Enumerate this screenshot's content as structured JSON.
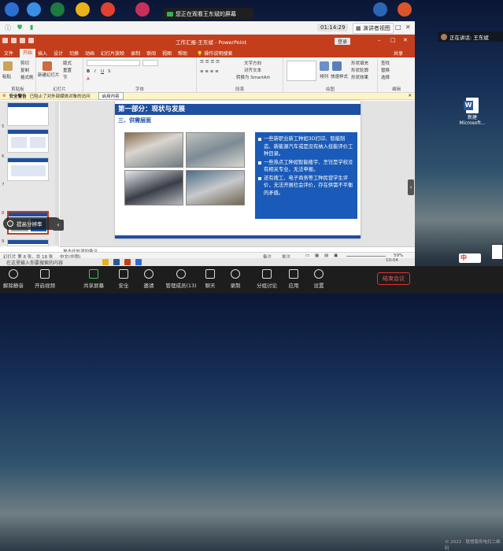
{
  "banner": {
    "text": "您正在观看王东斌的屏幕"
  },
  "zoom_toolbar": {
    "timer": "01:14:29",
    "view_button": "演讲者视图"
  },
  "speaker": {
    "label": "正在讲话: 王东斌"
  },
  "desktop": {
    "word_file": "新建 Microsoft..."
  },
  "ppt": {
    "title": "工作汇报-王东斌 - PowerPoint",
    "login": "登录",
    "tabs": [
      "文件",
      "开始",
      "插入",
      "设计",
      "切换",
      "动画",
      "幻灯片放映",
      "录制",
      "审阅",
      "视图",
      "帮助",
      "操作说明搜索"
    ],
    "share": "共享",
    "ribbon": {
      "clipboard": {
        "paste": "粘贴",
        "cut": "剪切",
        "copy": "复制",
        "format": "格式刷",
        "label": "剪贴板"
      },
      "slides": {
        "new": "新建幻灯片",
        "layout": "版式",
        "reset": "重置",
        "section": "节",
        "label": "幻灯片"
      },
      "font": {
        "label": "字体"
      },
      "paragraph": {
        "label": "段落",
        "textdir": "文字方向",
        "align": "对齐文本",
        "smartart": "转换为 SmartArt"
      },
      "drawing": {
        "shape_fill": "形状填充",
        "shape_outline": "形状轮廓",
        "shape_effect": "形状效果",
        "arrange": "排列",
        "quick": "快速样式",
        "label": "绘图"
      },
      "editing": {
        "find": "查找",
        "replace": "替换",
        "select": "选择",
        "label": "编辑"
      }
    },
    "security": {
      "title": "安全警告",
      "msg": "已阻止了对外部媒体对象的访问",
      "btn": "启用内容"
    },
    "slide_numbers": [
      "5",
      "6",
      "7",
      "8",
      "9"
    ],
    "slide": {
      "header": "第一部分：现状与发展",
      "subheader": "三、供需层面",
      "points": [
        "一些新职业新工种如3D打印、智能制造、新能源汽车或是没有纳入技能评价工种目录。",
        "一些热点工种如智能楼宇、烹饪是学校没有相关专业，无法申报。",
        "还有搜工、电子商务等工种民营学生评价，无法开展社会评价，存在供需不平衡的矛盾。"
      ]
    },
    "notes": "单击此处添加备注",
    "status": {
      "slide": "幻灯片 第 8 张，共 18 张",
      "lang": "中文(中国)",
      "notes": "备注",
      "comments": "批注",
      "zoom": "59%"
    }
  },
  "float_toolbar": {
    "label": "提高分辨率"
  },
  "taskbar": {
    "text": "在这里输入你要搜索的内容",
    "time": "10:04",
    "date": "2022/6/..."
  },
  "controls": {
    "items": [
      "解除静音",
      "开启视频",
      "共享屏幕",
      "安全",
      "邀请",
      "管理成员(13)",
      "聊天",
      "录制",
      "分组讨论",
      "应用",
      "设置"
    ],
    "end": "结束会议"
  },
  "tray": {
    "logo": "中"
  },
  "copyright": "© 2022 · 联想服务电扫二维码"
}
